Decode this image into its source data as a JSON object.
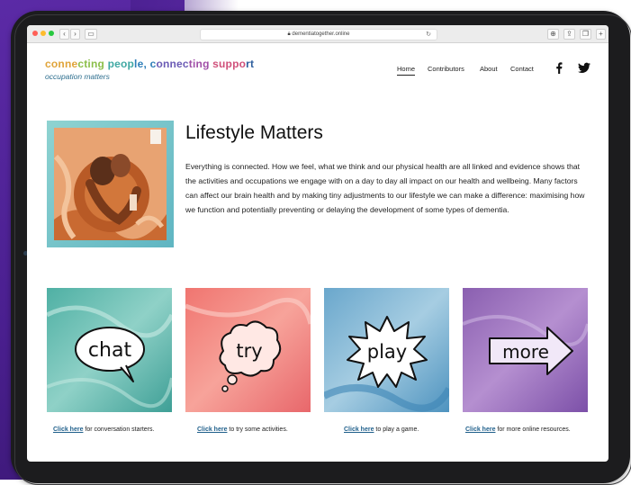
{
  "browser": {
    "url": "dementiatogether.online"
  },
  "site": {
    "tagline": "connecting people, connecting support",
    "subtitle": "occupation matters"
  },
  "nav": {
    "home": "Home",
    "contributors": "Contributors",
    "about": "About",
    "contact": "Contact"
  },
  "hero": {
    "title": "Lifestyle Matters",
    "paragraph": "Everything is connected. How we feel, what we think and our physical health are all linked and evidence shows that the activities and occupations we engage with on a day to day all impact on our health and wellbeing. Many factors can affect our brain health and by making tiny adjustments to our lifestyle we can make a difference: maximising how we function and potentially preventing or delaying the development of some types of dementia."
  },
  "cards": [
    {
      "word": "chat",
      "link": "Click here",
      "rest": " for conversation starters."
    },
    {
      "word": "try",
      "link": "Click here",
      "rest": " to try some activities."
    },
    {
      "word": "play",
      "link": "Click here",
      "rest": " to play a game."
    },
    {
      "word": "more",
      "link": "Click here",
      "rest": " for more online resources."
    }
  ],
  "colors": {
    "device": "#1c1c1e",
    "background_purple": "#4a1f8f",
    "link": "#1f5f8b",
    "card_chat": "#5cb8ac",
    "card_try": "#ee7c77",
    "card_play": "#7fb4d2",
    "card_more": "#9267b4"
  },
  "icons": {
    "facebook": "facebook-icon",
    "twitter": "twitter-icon",
    "lock": "lock-icon"
  }
}
